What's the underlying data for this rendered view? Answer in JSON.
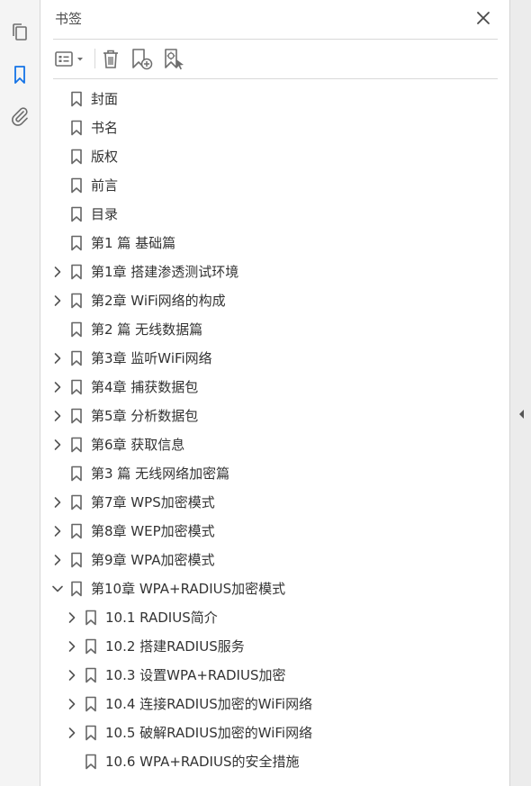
{
  "panel": {
    "title": "书签"
  },
  "rail": {
    "icons": [
      "pages-icon",
      "bookmark-icon",
      "attachment-icon"
    ]
  },
  "toolbar": {
    "buttons": [
      "options-menu-icon",
      "delete-bookmark-icon",
      "new-bookmark-icon",
      "new-bookmark-from-selection-icon"
    ]
  },
  "bookmarks": [
    {
      "label": "封面",
      "level": 0,
      "expander": "none"
    },
    {
      "label": "书名",
      "level": 0,
      "expander": "none"
    },
    {
      "label": "版权",
      "level": 0,
      "expander": "none"
    },
    {
      "label": "前言",
      "level": 0,
      "expander": "none"
    },
    {
      "label": "目录",
      "level": 0,
      "expander": "none"
    },
    {
      "label": "第1 篇 基础篇",
      "level": 0,
      "expander": "none"
    },
    {
      "label": "第1章 搭建渗透测试环境",
      "level": 0,
      "expander": "collapsed"
    },
    {
      "label": "第2章 WiFi网络的构成",
      "level": 0,
      "expander": "collapsed"
    },
    {
      "label": "第2 篇 无线数据篇",
      "level": 0,
      "expander": "none"
    },
    {
      "label": "第3章 监听WiFi网络",
      "level": 0,
      "expander": "collapsed"
    },
    {
      "label": "第4章 捕获数据包",
      "level": 0,
      "expander": "collapsed"
    },
    {
      "label": "第5章 分析数据包",
      "level": 0,
      "expander": "collapsed"
    },
    {
      "label": "第6章 获取信息",
      "level": 0,
      "expander": "collapsed"
    },
    {
      "label": "第3 篇 无线网络加密篇",
      "level": 0,
      "expander": "none"
    },
    {
      "label": "第7章 WPS加密模式",
      "level": 0,
      "expander": "collapsed"
    },
    {
      "label": "第8章 WEP加密模式",
      "level": 0,
      "expander": "collapsed"
    },
    {
      "label": "第9章 WPA加密模式",
      "level": 0,
      "expander": "collapsed"
    },
    {
      "label": "第10章 WPA+RADIUS加密模式",
      "level": 0,
      "expander": "expanded"
    },
    {
      "label": "10.1 RADIUS简介",
      "level": 1,
      "expander": "collapsed"
    },
    {
      "label": "10.2 搭建RADIUS服务",
      "level": 1,
      "expander": "collapsed"
    },
    {
      "label": "10.3 设置WPA+RADIUS加密",
      "level": 1,
      "expander": "collapsed"
    },
    {
      "label": "10.4 连接RADIUS加密的WiFi网络",
      "level": 1,
      "expander": "collapsed"
    },
    {
      "label": "10.5 破解RADIUS加密的WiFi网络",
      "level": 1,
      "expander": "collapsed"
    },
    {
      "label": "10.6 WPA+RADIUS的安全措施",
      "level": 1,
      "expander": "none"
    }
  ],
  "colors": {
    "active_icon": "#1473e6",
    "icon_gray": "#6e6e6e",
    "text": "#333333"
  }
}
